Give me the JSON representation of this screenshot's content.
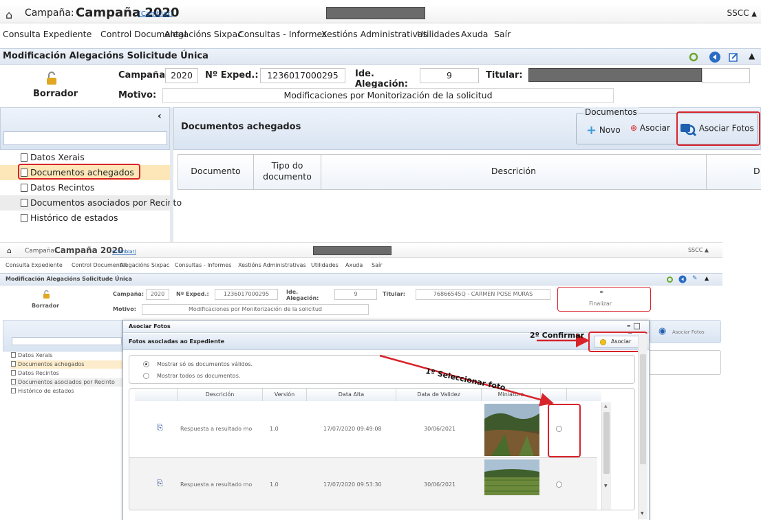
{
  "top": {
    "campaign_label": "Campaña:",
    "campaign_value": "Campaña 2020",
    "change_link": "(Cambiar)",
    "user": "SSCC",
    "menu": [
      "Consulta Expediente",
      "Control Documental",
      "Alegacións Sixpac",
      "Consultas - Informes",
      "Xestións Administrativas",
      "Utilidades",
      "Axuda",
      "Saír"
    ],
    "module_title": "Modificación Alegacións Solicitude Única",
    "status": "Borrador",
    "fields": {
      "campaign_label": "Campaña:",
      "campaign_value": "2020",
      "exped_label": "Nº Exped.:",
      "exped_value": "1236017000295",
      "alegacion_label_1": "Ide.",
      "alegacion_label_2": "Alegación:",
      "alegacion_value": "9",
      "titular_label": "Titular:",
      "motivo_label": "Motivo:",
      "motivo_value": "Modificaciones por Monitorización de la solicitud"
    },
    "sidebar_items": [
      "Datos Xerais",
      "Documentos achegados",
      "Datos Recintos",
      "Documentos asociados por Recinto",
      "Histórico de estados"
    ],
    "content_title": "Documentos achegados",
    "documents_group": "Documentos",
    "btn_new": "Novo",
    "btn_associate": "Asociar",
    "btn_associate_photos": "Asociar Fotos",
    "grid_headers": [
      "Documento",
      "Tipo do documento",
      "Descrición",
      "D"
    ]
  },
  "bottom": {
    "campaign_label": "Campaña:",
    "campaign_value": "Campaña 2020",
    "change_link": "(Cambiar)",
    "user": "SSCC",
    "menu": [
      "Consulta Expediente",
      "Control Documental",
      "Alegacións Sixpac",
      "Consultas - Informes",
      "Xestións Administrativas",
      "Utilidades",
      "Axuda",
      "Saír"
    ],
    "module_title": "Modificación Alegacións Solicitude Única",
    "status": "Borrador",
    "fields": {
      "campaign_label": "Campaña:",
      "campaign_value": "2020",
      "exped_label": "Nº Exped.:",
      "exped_value": "1236017000295",
      "alegacion_label_1": "Ide.",
      "alegacion_label_2": "Alegación:",
      "alegacion_value": "9",
      "titular_label": "Titular:",
      "titular_value": "76866545Q - CARMEN POSE MURAS",
      "motivo_label": "Motivo:",
      "motivo_value": "Modificaciones por Monitorización de la solicitud"
    },
    "finalizar": "Finalizar",
    "sidebar_items": [
      "Datos Xerais",
      "Documentos achegados",
      "Datos Recintos",
      "Documentos asociados por Recinto",
      "Histórico de estados"
    ],
    "bg_associate_photos": "Asociar Fotos",
    "dialog": {
      "title": "Asociar Fotos",
      "subtitle": "Fotos asociadas ao Expediente",
      "associate_button": "Asociar",
      "radio_valid": "Mostrar só os documentos válidos.",
      "radio_all": "Mostrar todos os documentos.",
      "columns": [
        "Descrición",
        "Versión",
        "Data Alta",
        "Data de Validez",
        "Miniatura"
      ],
      "rows": [
        {
          "description": "Respuesta a resultado mo",
          "version": "1.0",
          "created": "17/07/2020 09:49:08",
          "valid_until": "30/06/2021"
        },
        {
          "description": "Respuesta a resultado mo",
          "version": "1.0",
          "created": "17/07/2020 09:53:30",
          "valid_until": "30/06/2021"
        }
      ]
    },
    "annotation_confirm": "2º Confirmar",
    "annotation_select": "1º Seleccionar foto"
  },
  "colors": {
    "highlight_red": "#d8232a",
    "link_blue": "#1a5fb4",
    "header_blue": "#dfe7f2"
  }
}
